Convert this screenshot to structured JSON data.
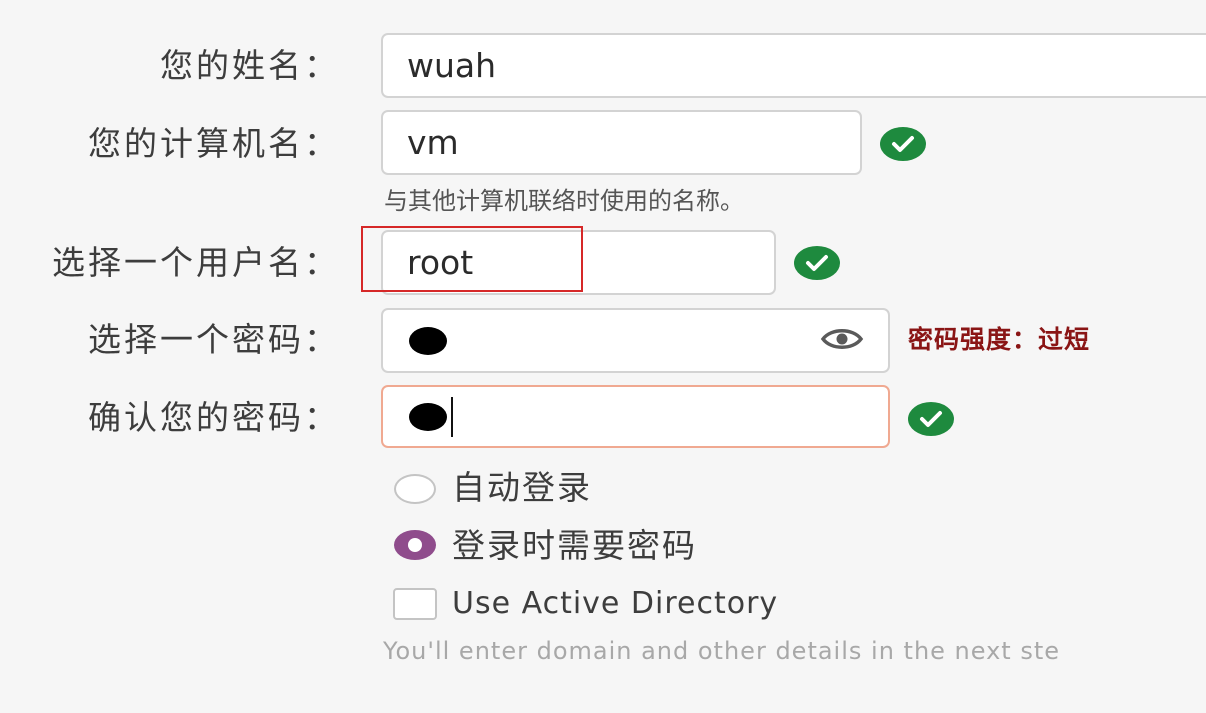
{
  "form": {
    "name": {
      "label": "您的姓名：",
      "value": "wuah"
    },
    "computer": {
      "label": "您的计算机名：",
      "value": "vm",
      "hint": "与其他计算机联络时使用的名称。"
    },
    "username": {
      "label": "选择一个用户名：",
      "value": "root"
    },
    "password": {
      "label": "选择一个密码：",
      "strength": "密码强度：过短",
      "masked_length": 1
    },
    "confirm": {
      "label": "确认您的密码：",
      "masked_length": 1
    },
    "login_options": [
      {
        "label": "自动登录",
        "selected": false
      },
      {
        "label": "登录时需要密码",
        "selected": true
      }
    ],
    "active_directory": {
      "label": "Use Active Directory",
      "checked": false,
      "hint": "You'll enter domain and other details in the next ste"
    }
  },
  "colors": {
    "check_ok": "#1e8a3e",
    "strength_text": "#8a1515",
    "radio_selected": "#8f4c8c",
    "focus_border": "#f0a991",
    "annotation_box": "#d62828"
  },
  "icons": {
    "valid": "check-circle-icon",
    "reveal": "eye-icon"
  }
}
